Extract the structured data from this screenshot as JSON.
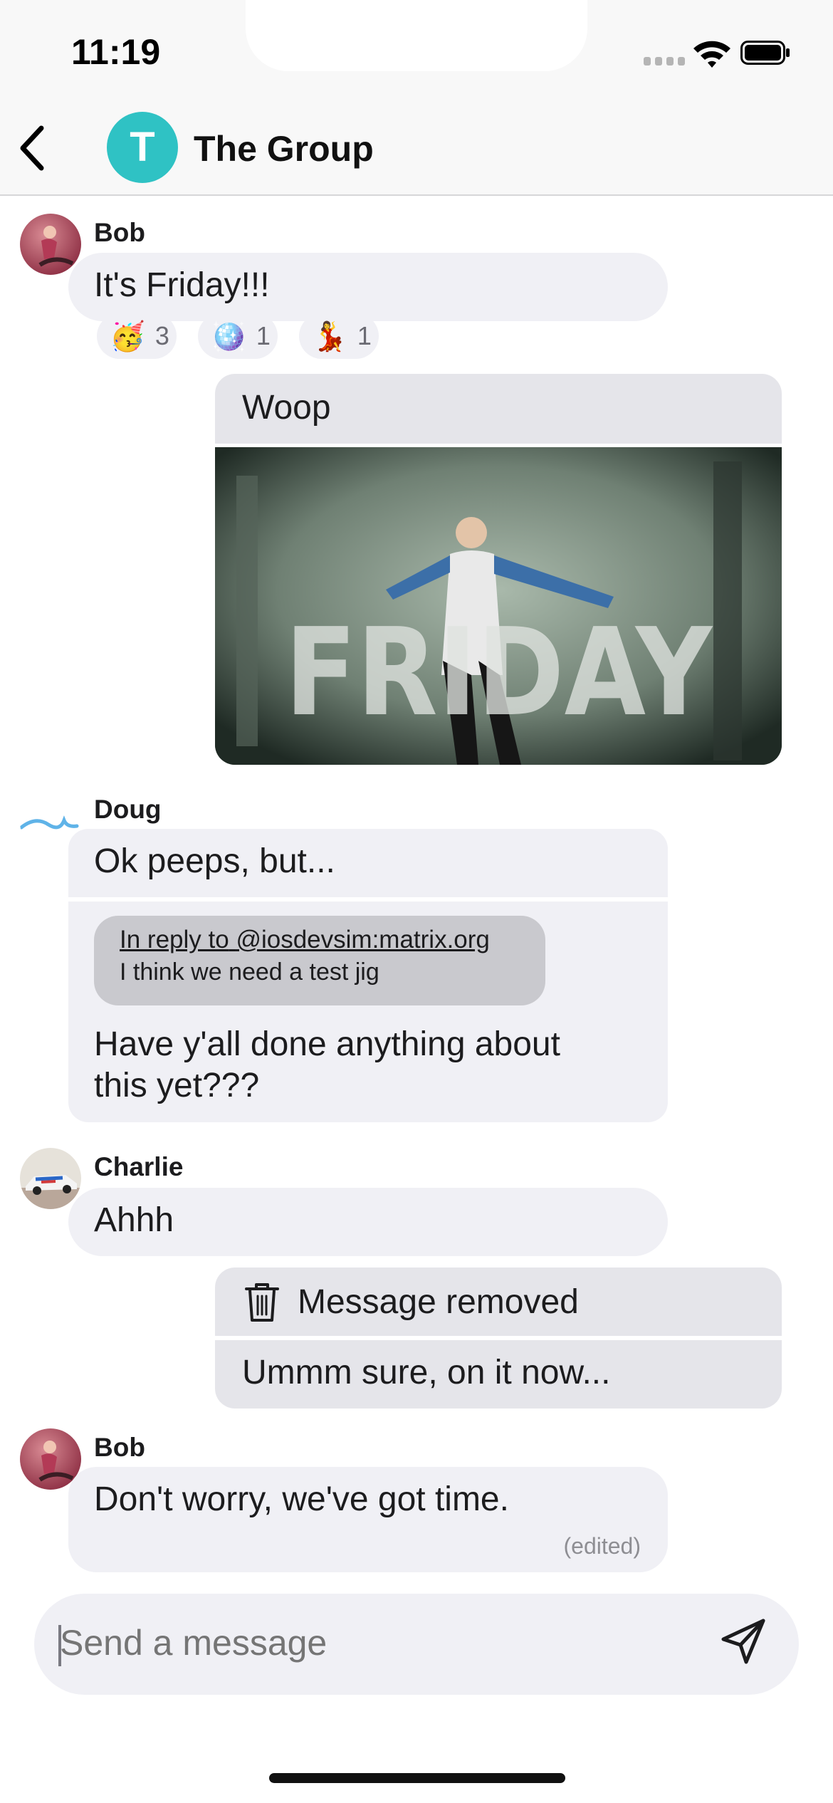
{
  "status": {
    "time": "11:19"
  },
  "header": {
    "avatar_letter": "T",
    "title": "The Group",
    "avatar_color": "#2fc2c4"
  },
  "messages": {
    "bob1": {
      "sender": "Bob",
      "text": "It's Friday!!!",
      "reactions": [
        {
          "emoji": "🥳",
          "count": "3"
        },
        {
          "emoji": "🪩",
          "count": "1"
        },
        {
          "emoji": "💃",
          "count": "1"
        }
      ]
    },
    "own1": {
      "text": "Woop",
      "image_text": "FRIDAY"
    },
    "doug": {
      "sender": "Doug",
      "text": "Ok peeps, but...",
      "reply_prefix": "In reply to",
      "reply_user": "@iosdevsim:matrix.org",
      "reply_quote": "I think we need a test jig",
      "reply_text_line1": "Have y'all done anything about",
      "reply_text_line2": "this yet???"
    },
    "charlie": {
      "sender": "Charlie",
      "text": "Ahhh"
    },
    "own2": {
      "removed": "Message removed",
      "text": "Ummm sure, on it now..."
    },
    "bob2": {
      "sender": "Bob",
      "text": "Don't worry, we've got time.",
      "edited": "(edited)"
    }
  },
  "composer": {
    "placeholder": "Send a message"
  },
  "icons": {
    "back": "chevron-left-icon",
    "send": "paper-plane-icon",
    "trash": "trash-icon"
  }
}
